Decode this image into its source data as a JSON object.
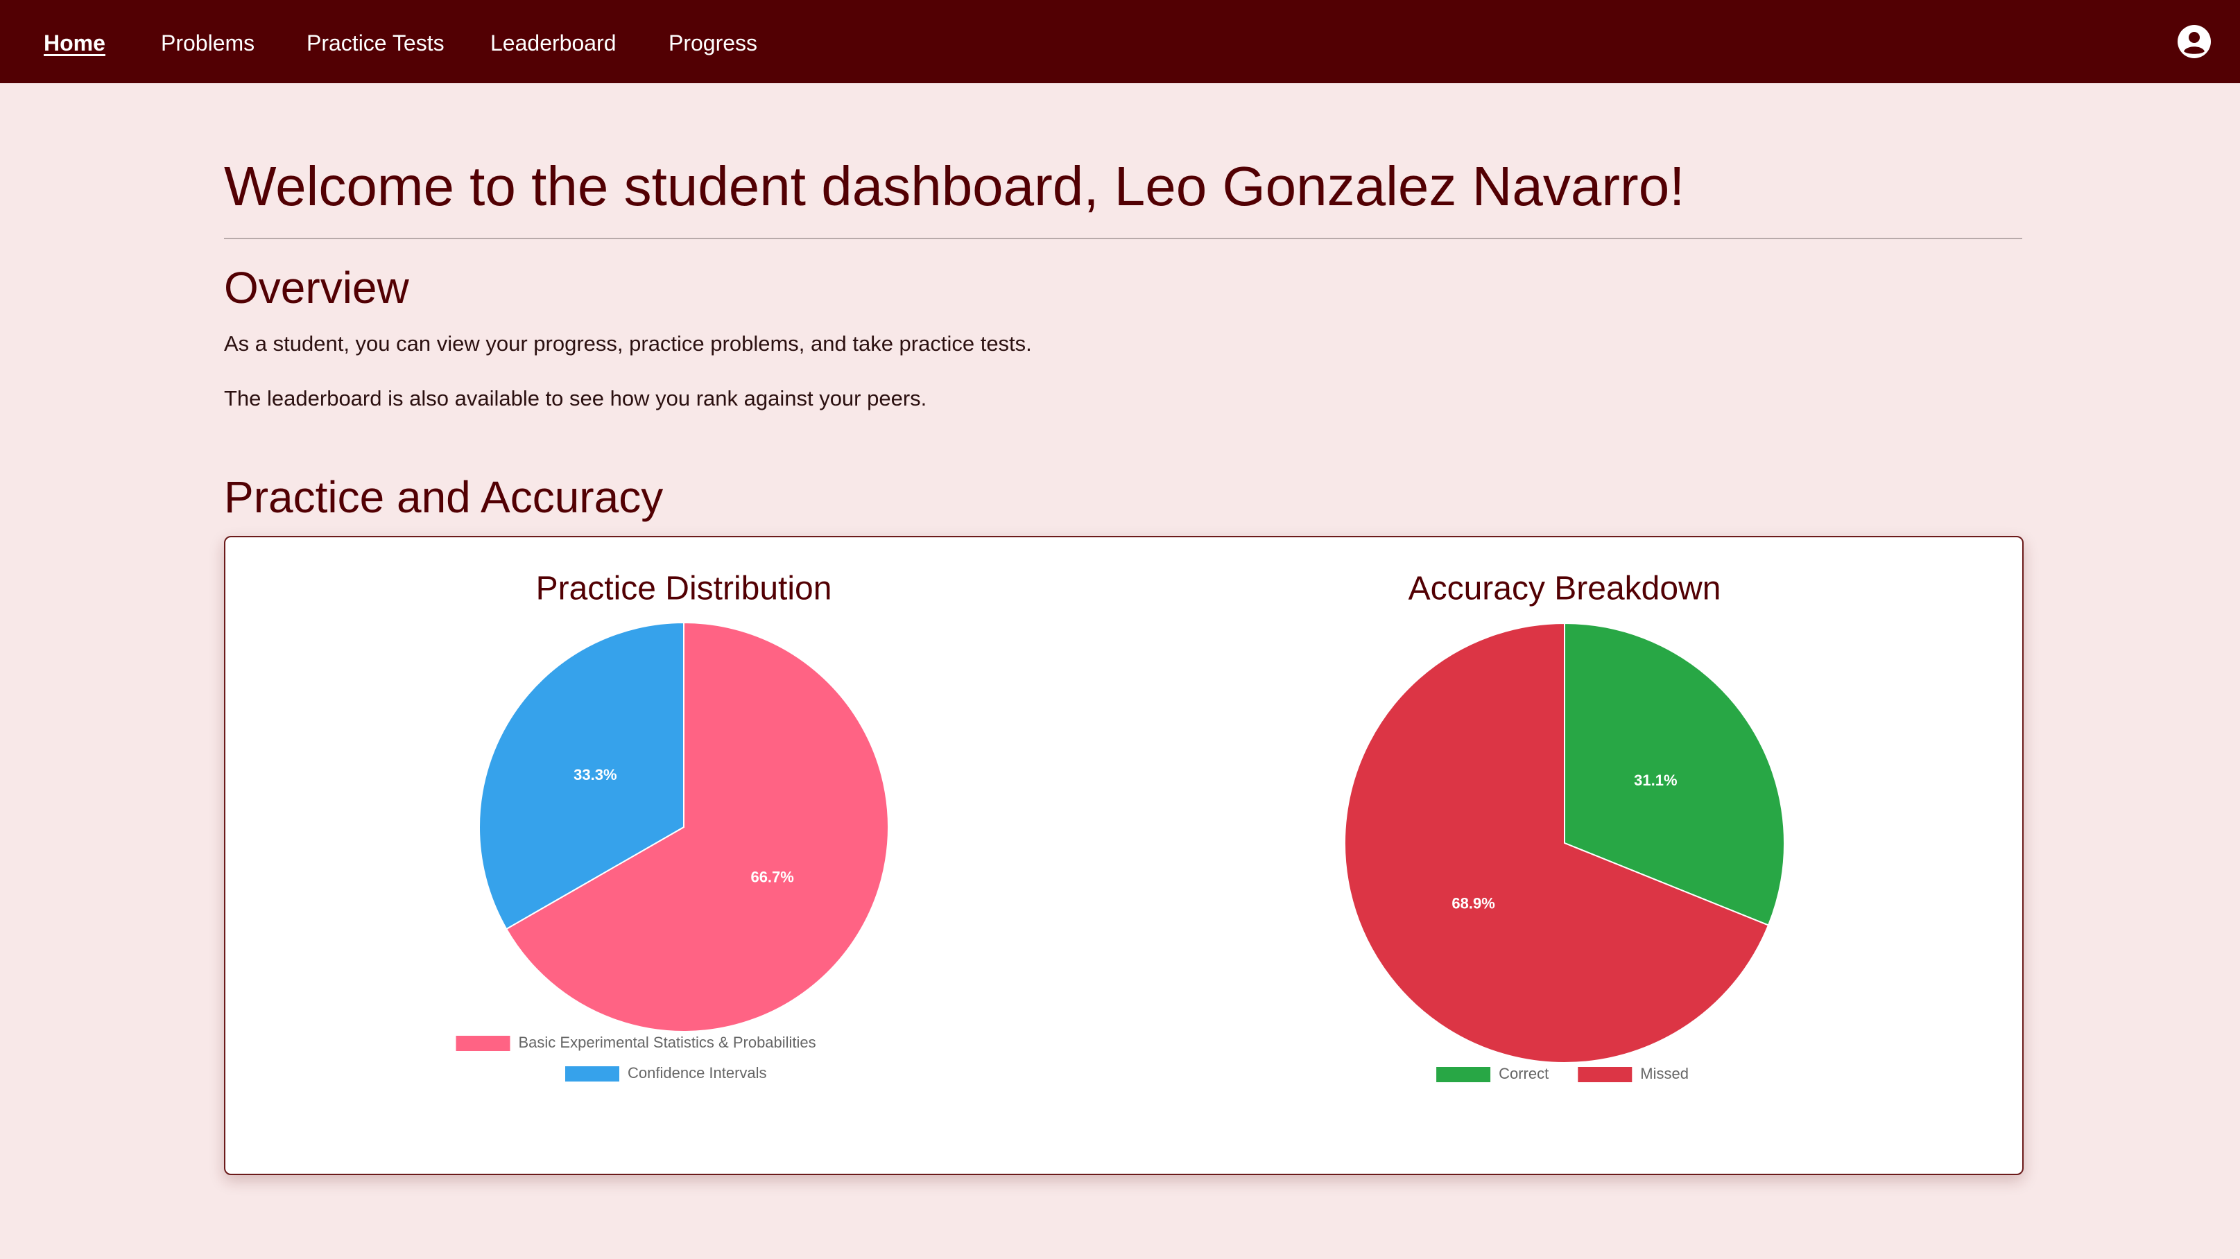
{
  "nav": {
    "items": [
      {
        "label": "Home",
        "active": true
      },
      {
        "label": "Problems",
        "active": false
      },
      {
        "label": "Practice Tests",
        "active": false
      },
      {
        "label": "Leaderboard",
        "active": false
      },
      {
        "label": "Progress",
        "active": false
      }
    ],
    "account_icon": "account-circle-icon"
  },
  "main": {
    "title": "Welcome to the student dashboard, Leo Gonzalez Navarro!",
    "overview_heading": "Overview",
    "overview_text_1": "As a student, you can view your progress, practice problems, and take practice tests.",
    "overview_text_2": "The leaderboard is also available to see how you rank against your peers.",
    "practice_heading": "Practice and Accuracy"
  },
  "colors": {
    "nav_background": "#520003",
    "page_background": "#f8e8e8",
    "heading": "#520003"
  },
  "chart_data": [
    {
      "type": "pie",
      "title": "Practice Distribution",
      "categories": [
        "Basic Experimental Statistics & Probabilities",
        "Confidence Intervals"
      ],
      "values": [
        66.7,
        33.3
      ],
      "labels": [
        "66.7%",
        "33.3%"
      ],
      "colors": [
        "#ff6384",
        "#36a2eb"
      ],
      "legend": "bottom"
    },
    {
      "type": "pie",
      "title": "Accuracy Breakdown",
      "categories": [
        "Correct",
        "Missed"
      ],
      "values": [
        31.1,
        68.9
      ],
      "labels": [
        "31.1%",
        "68.9%"
      ],
      "colors": [
        "#28a745",
        "#dc3545"
      ],
      "legend": "bottom"
    }
  ]
}
